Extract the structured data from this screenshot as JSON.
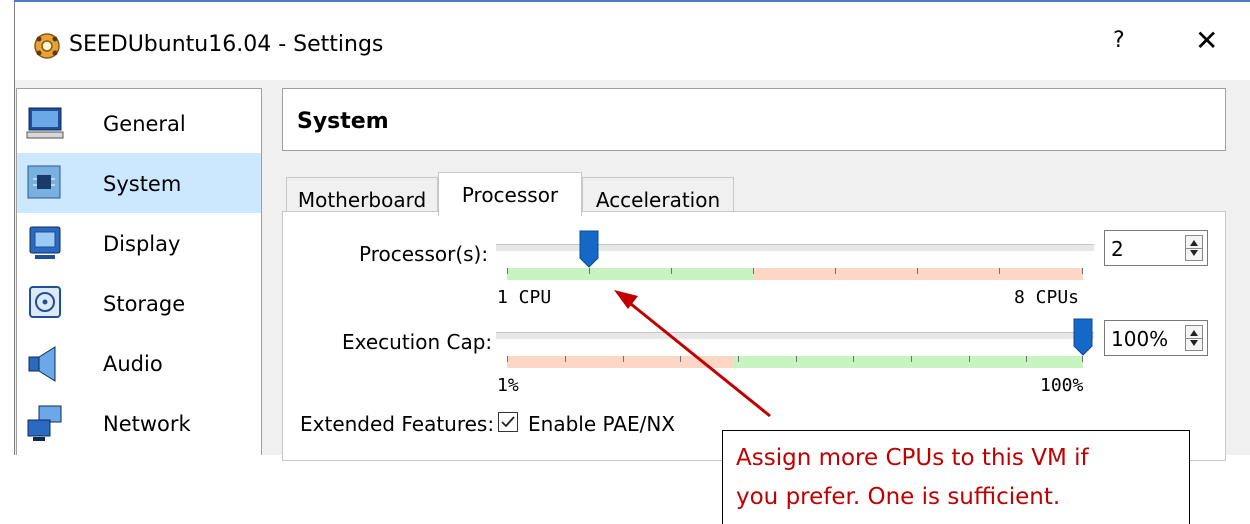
{
  "window": {
    "title": "SEEDUbuntu16.04 - Settings",
    "help_label": "?",
    "close_label": "✕"
  },
  "sidebar": {
    "items": [
      {
        "label": "General",
        "icon": "monitor-icon"
      },
      {
        "label": "System",
        "icon": "chip-icon",
        "selected": true
      },
      {
        "label": "Display",
        "icon": "display-icon"
      },
      {
        "label": "Storage",
        "icon": "disk-icon"
      },
      {
        "label": "Audio",
        "icon": "speaker-icon"
      },
      {
        "label": "Network",
        "icon": "network-icon"
      }
    ]
  },
  "section": {
    "title": "System"
  },
  "tabs": [
    {
      "label": "Motherboard"
    },
    {
      "label": "Processor",
      "active": true
    },
    {
      "label": "Acceleration"
    }
  ],
  "processor": {
    "label": "Processor(s):",
    "value": "2",
    "min_label": "1 CPU",
    "max_label": "8 CPUs"
  },
  "execution_cap": {
    "label": "Execution Cap:",
    "value": "100%",
    "min_label": "1%",
    "max_label": "100%"
  },
  "extended_features": {
    "label": "Extended Features:",
    "checkbox_label": "Enable PAE/NX",
    "checked": true
  },
  "callout": {
    "text": "Assign more CPUs to this VM if\nyou prefer. One is sufficient."
  },
  "colors": {
    "selection": "#cce8ff",
    "green_range": "#c6f3c0",
    "red_range": "#fdd6c6",
    "thumb": "#1469c8",
    "callout_text": "#c00000",
    "arrow": "#c00000"
  }
}
